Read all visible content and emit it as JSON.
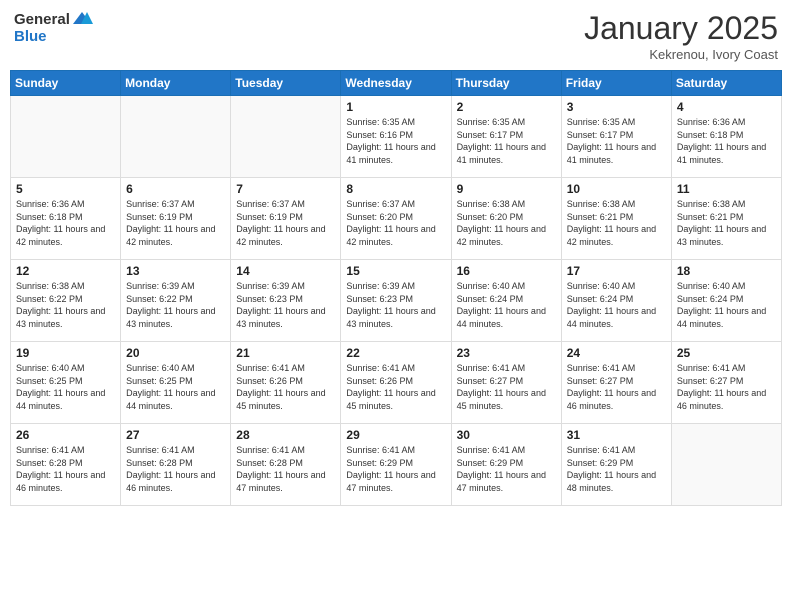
{
  "header": {
    "logo_general": "General",
    "logo_blue": "Blue",
    "month": "January 2025",
    "location": "Kekrenou, Ivory Coast"
  },
  "weekdays": [
    "Sunday",
    "Monday",
    "Tuesday",
    "Wednesday",
    "Thursday",
    "Friday",
    "Saturday"
  ],
  "weeks": [
    [
      {
        "day": "",
        "sunrise": "",
        "sunset": "",
        "daylight": ""
      },
      {
        "day": "",
        "sunrise": "",
        "sunset": "",
        "daylight": ""
      },
      {
        "day": "",
        "sunrise": "",
        "sunset": "",
        "daylight": ""
      },
      {
        "day": "1",
        "sunrise": "6:35 AM",
        "sunset": "6:16 PM",
        "daylight": "11 hours and 41 minutes."
      },
      {
        "day": "2",
        "sunrise": "6:35 AM",
        "sunset": "6:17 PM",
        "daylight": "11 hours and 41 minutes."
      },
      {
        "day": "3",
        "sunrise": "6:35 AM",
        "sunset": "6:17 PM",
        "daylight": "11 hours and 41 minutes."
      },
      {
        "day": "4",
        "sunrise": "6:36 AM",
        "sunset": "6:18 PM",
        "daylight": "11 hours and 41 minutes."
      }
    ],
    [
      {
        "day": "5",
        "sunrise": "6:36 AM",
        "sunset": "6:18 PM",
        "daylight": "11 hours and 42 minutes."
      },
      {
        "day": "6",
        "sunrise": "6:37 AM",
        "sunset": "6:19 PM",
        "daylight": "11 hours and 42 minutes."
      },
      {
        "day": "7",
        "sunrise": "6:37 AM",
        "sunset": "6:19 PM",
        "daylight": "11 hours and 42 minutes."
      },
      {
        "day": "8",
        "sunrise": "6:37 AM",
        "sunset": "6:20 PM",
        "daylight": "11 hours and 42 minutes."
      },
      {
        "day": "9",
        "sunrise": "6:38 AM",
        "sunset": "6:20 PM",
        "daylight": "11 hours and 42 minutes."
      },
      {
        "day": "10",
        "sunrise": "6:38 AM",
        "sunset": "6:21 PM",
        "daylight": "11 hours and 42 minutes."
      },
      {
        "day": "11",
        "sunrise": "6:38 AM",
        "sunset": "6:21 PM",
        "daylight": "11 hours and 43 minutes."
      }
    ],
    [
      {
        "day": "12",
        "sunrise": "6:38 AM",
        "sunset": "6:22 PM",
        "daylight": "11 hours and 43 minutes."
      },
      {
        "day": "13",
        "sunrise": "6:39 AM",
        "sunset": "6:22 PM",
        "daylight": "11 hours and 43 minutes."
      },
      {
        "day": "14",
        "sunrise": "6:39 AM",
        "sunset": "6:23 PM",
        "daylight": "11 hours and 43 minutes."
      },
      {
        "day": "15",
        "sunrise": "6:39 AM",
        "sunset": "6:23 PM",
        "daylight": "11 hours and 43 minutes."
      },
      {
        "day": "16",
        "sunrise": "6:40 AM",
        "sunset": "6:24 PM",
        "daylight": "11 hours and 44 minutes."
      },
      {
        "day": "17",
        "sunrise": "6:40 AM",
        "sunset": "6:24 PM",
        "daylight": "11 hours and 44 minutes."
      },
      {
        "day": "18",
        "sunrise": "6:40 AM",
        "sunset": "6:24 PM",
        "daylight": "11 hours and 44 minutes."
      }
    ],
    [
      {
        "day": "19",
        "sunrise": "6:40 AM",
        "sunset": "6:25 PM",
        "daylight": "11 hours and 44 minutes."
      },
      {
        "day": "20",
        "sunrise": "6:40 AM",
        "sunset": "6:25 PM",
        "daylight": "11 hours and 44 minutes."
      },
      {
        "day": "21",
        "sunrise": "6:41 AM",
        "sunset": "6:26 PM",
        "daylight": "11 hours and 45 minutes."
      },
      {
        "day": "22",
        "sunrise": "6:41 AM",
        "sunset": "6:26 PM",
        "daylight": "11 hours and 45 minutes."
      },
      {
        "day": "23",
        "sunrise": "6:41 AM",
        "sunset": "6:27 PM",
        "daylight": "11 hours and 45 minutes."
      },
      {
        "day": "24",
        "sunrise": "6:41 AM",
        "sunset": "6:27 PM",
        "daylight": "11 hours and 46 minutes."
      },
      {
        "day": "25",
        "sunrise": "6:41 AM",
        "sunset": "6:27 PM",
        "daylight": "11 hours and 46 minutes."
      }
    ],
    [
      {
        "day": "26",
        "sunrise": "6:41 AM",
        "sunset": "6:28 PM",
        "daylight": "11 hours and 46 minutes."
      },
      {
        "day": "27",
        "sunrise": "6:41 AM",
        "sunset": "6:28 PM",
        "daylight": "11 hours and 46 minutes."
      },
      {
        "day": "28",
        "sunrise": "6:41 AM",
        "sunset": "6:28 PM",
        "daylight": "11 hours and 47 minutes."
      },
      {
        "day": "29",
        "sunrise": "6:41 AM",
        "sunset": "6:29 PM",
        "daylight": "11 hours and 47 minutes."
      },
      {
        "day": "30",
        "sunrise": "6:41 AM",
        "sunset": "6:29 PM",
        "daylight": "11 hours and 47 minutes."
      },
      {
        "day": "31",
        "sunrise": "6:41 AM",
        "sunset": "6:29 PM",
        "daylight": "11 hours and 48 minutes."
      },
      {
        "day": "",
        "sunrise": "",
        "sunset": "",
        "daylight": ""
      }
    ]
  ]
}
